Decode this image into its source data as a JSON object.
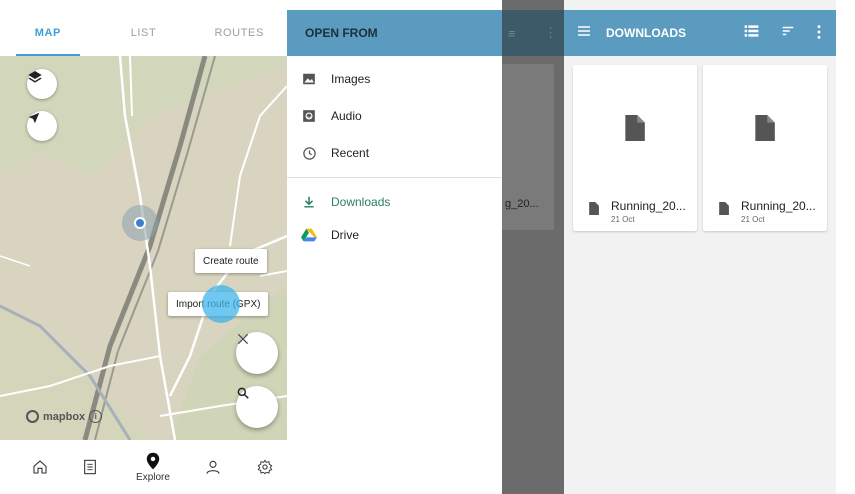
{
  "map_app": {
    "tabs": [
      {
        "label": "MAP",
        "active": true
      },
      {
        "label": "LIST",
        "active": false
      },
      {
        "label": "ROUTES",
        "active": false
      }
    ],
    "controls": {
      "layers_icon": "layers-icon",
      "locate_icon": "navigation-arrow-icon"
    },
    "popup_actions": {
      "create_route": "Create route",
      "import_route": "Import route (GPX)"
    },
    "fabs": {
      "close_icon": "close-icon",
      "search_icon": "search-icon"
    },
    "attribution": "mapbox",
    "bottom_nav": [
      {
        "icon": "home-icon",
        "label": ""
      },
      {
        "icon": "list-icon",
        "label": ""
      },
      {
        "icon": "location-pin-icon",
        "label": "Explore"
      },
      {
        "icon": "person-icon",
        "label": ""
      },
      {
        "icon": "settings-icon",
        "label": ""
      }
    ]
  },
  "open_from": {
    "title": "OPEN FROM",
    "items": [
      {
        "label": "Images",
        "icon": "image-icon"
      },
      {
        "label": "Audio",
        "icon": "audio-icon"
      },
      {
        "label": "Recent",
        "icon": "clock-icon"
      },
      {
        "label": "Downloads",
        "icon": "download-icon",
        "active": true
      },
      {
        "label": "Drive",
        "icon": "drive-icon"
      }
    ],
    "background_card_text": "g_20..."
  },
  "downloads": {
    "title": "DOWNLOADS",
    "files": [
      {
        "name": "Running_20...",
        "date": "21 Oct"
      },
      {
        "name": "Running_20...",
        "date": "21 Oct"
      }
    ]
  },
  "colors": {
    "header_blue": "#5a9bbf",
    "tab_accent": "#3fa0d6",
    "active_item": "#2e7d6a",
    "map_bg": "#d8d4bf"
  }
}
